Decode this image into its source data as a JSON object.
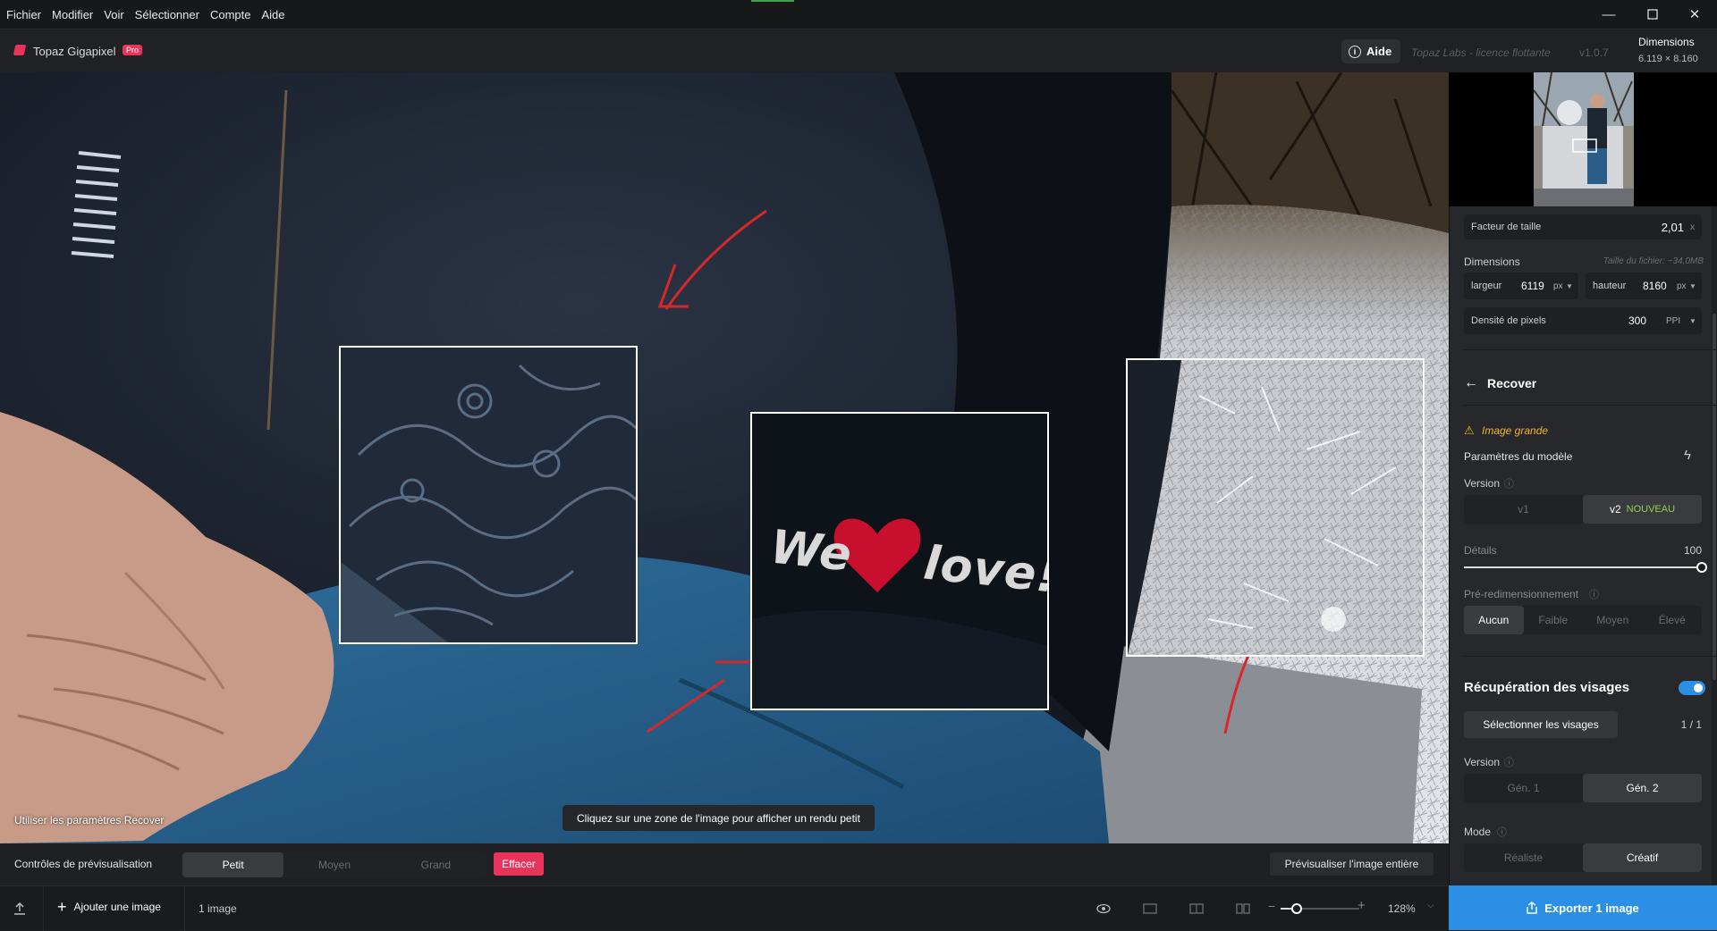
{
  "menu": [
    "Fichier",
    "Modifier",
    "Voir",
    "Sélectionner",
    "Compte",
    "Aide"
  ],
  "app": {
    "name": "Topaz Gigapixel",
    "badge": "Pro",
    "help_label": "Aide",
    "license": "Topaz Labs - licence flottante",
    "version": "v1.0.7"
  },
  "dimensions_header": {
    "title": "Dimensions",
    "value": "6.119 × 8.160"
  },
  "canvas": {
    "recover_label": "Utiliser les paramètres Recover",
    "hint": "Cliquez sur une zone de l'image pour afficher un rendu petit",
    "patch_text": "We love!!"
  },
  "panel": {
    "scale": {
      "label": "Facteur de taille",
      "value": "2,01",
      "unit": "x"
    },
    "dimensions": {
      "label": "Dimensions",
      "file_size": "Taille du fichier: ~34,0MB",
      "width_label": "largeur",
      "width_value": "6119",
      "width_unit": "px",
      "height_label": "hauteur",
      "height_value": "8160",
      "height_unit": "px"
    },
    "density": {
      "label": "Densité de pixels",
      "value": "300",
      "unit": "PPI"
    },
    "model": {
      "name": "Recover",
      "warning": "Image grande",
      "params_label": "Paramètres du modèle",
      "version_label": "Version",
      "versions": [
        "v1",
        "v2"
      ],
      "new_badge": "NOUVEAU",
      "details_label": "Détails",
      "details_value": "100",
      "details_fraction": 1.0,
      "preresize_label": "Pré-redimensionnement",
      "preresize_options": [
        "Aucun",
        "Faible",
        "Moyen",
        "Élevé"
      ]
    },
    "faces": {
      "title": "Récupération des visages",
      "select_label": "Sélectionner les visages",
      "count": "1 / 1",
      "version_label": "Version",
      "versions": [
        "Gén. 1",
        "Gén. 2"
      ],
      "mode_label": "Mode",
      "modes": [
        "Réaliste",
        "Créatif"
      ]
    }
  },
  "preview_controls": {
    "label": "Contrôles de prévisualisation",
    "sizes": [
      "Petit",
      "Moyen",
      "Grand"
    ],
    "clear": "Effacer",
    "preview_all": "Prévisualiser l'image entière"
  },
  "footer": {
    "add_image": "Ajouter une image",
    "image_count": "1 image",
    "zoom": "128%",
    "export": "Exporter 1 image"
  },
  "colors": {
    "accent": "#2b8fe6",
    "brand": "#e8335a",
    "new_badge": "#8fd14f",
    "warning": "#f0b429"
  }
}
